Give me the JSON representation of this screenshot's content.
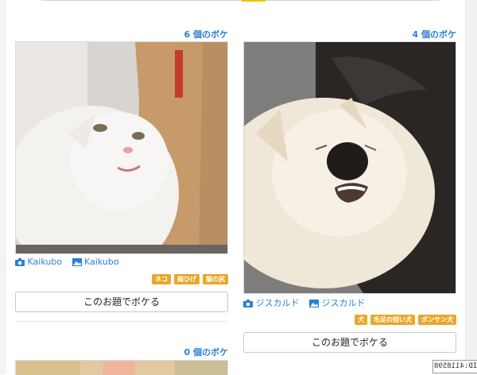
{
  "cards": [
    {
      "count": "6 個のボケ",
      "photographer": "Kaikubo",
      "uploader": "Kaikubo",
      "tags": [
        "ネコ",
        "痴ひげ",
        "猫の尻"
      ],
      "button": "このお題でボケる"
    },
    {
      "count": "4 個のボケ",
      "photographer": "ジスカルド",
      "uploader": "ジスカルド",
      "tags": [
        "犬",
        "毛足の短い犬",
        "ボンサン犬"
      ],
      "button": "このお題でボケる"
    },
    {
      "count": "0 個のボケ"
    }
  ],
  "overlay_id": "ID:4118598",
  "colors": {
    "link": "#2a7fd4",
    "tag": "#e9a72a",
    "accent": "#f0c000"
  }
}
